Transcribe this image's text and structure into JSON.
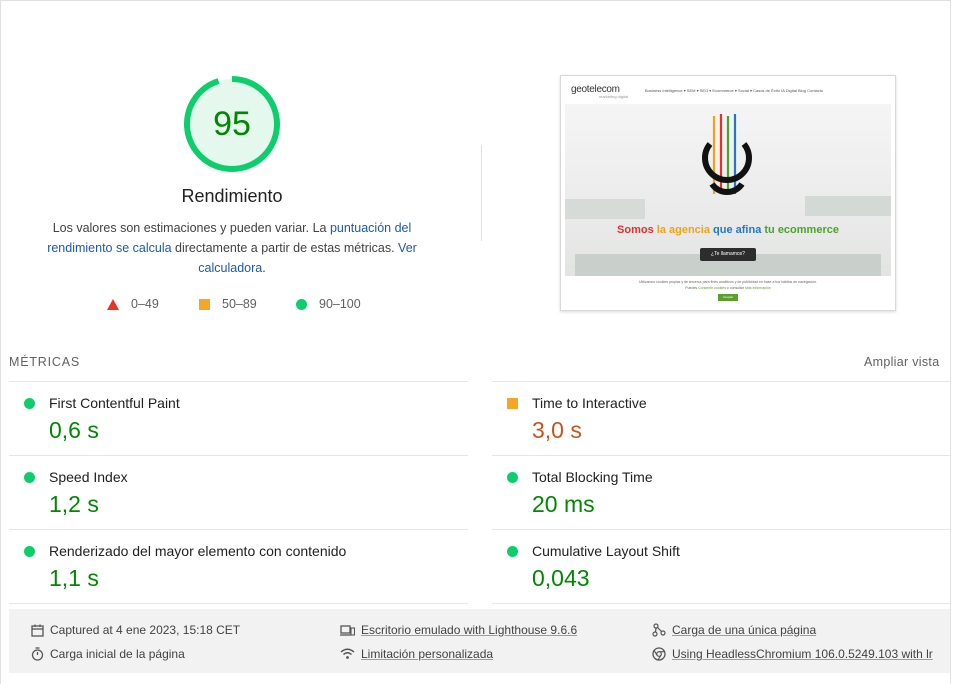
{
  "score": {
    "value": "95",
    "fraction": 0.95,
    "title": "Rendimiento",
    "color": "#0cce6b"
  },
  "description": {
    "text_1": "Los valores son estimaciones y pueden variar. La ",
    "link_1": "puntuación del rendimiento se calcula",
    "text_2": " directamente a partir de estas métricas. ",
    "link_2": "Ver calculadora",
    "text_3": "."
  },
  "legend": {
    "fail": "0–49",
    "average": "50–89",
    "pass": "90–100",
    "colors": {
      "fail": "#eb3324",
      "average": "#f4a626",
      "pass": "#0cce6b"
    }
  },
  "screenshot": {
    "logo": "geotelecom",
    "logo_sub": "marketing digital",
    "nav": "Business Intelligence ▾   SEM ▾   SEO ▾   Ecommerce ▾   Social ▾   Casos de Éxito   IA Digital   Blog   Contacto",
    "tagline_parts": [
      {
        "text": "Somos ",
        "color": "#e3312b"
      },
      {
        "text": "la agencia ",
        "color": "#f0a21a"
      },
      {
        "text": "que afina ",
        "color": "#1f78c8"
      },
      {
        "text": "tu ecommerce",
        "color": "#4ba32d"
      }
    ],
    "cta": "¿Te llamamos?",
    "footer_line1": "Utilizamos cookies propias y de terceros para fines analíticos y de publicidad en base a tus hábitos de navegación.",
    "footer_line2_prefix": "Puedes ",
    "footer_line2_link1": "Consentir cookies",
    "footer_line2_mid": " o consultar ",
    "footer_line2_link2": "Más información",
    "accept_button": "Aceptar"
  },
  "metrics": {
    "title": "MÉTRICAS",
    "expand_label": "Ampliar vista",
    "items": [
      {
        "label": "First Contentful Paint",
        "value": "0,6 s",
        "status": "pass"
      },
      {
        "label": "Time to Interactive",
        "value": "3,0 s",
        "status": "average"
      },
      {
        "label": "Speed Index",
        "value": "1,2 s",
        "status": "pass"
      },
      {
        "label": "Total Blocking Time",
        "value": "20 ms",
        "status": "pass"
      },
      {
        "label": "Renderizado del mayor elemento con contenido",
        "value": "1,1 s",
        "status": "pass"
      },
      {
        "label": "Cumulative Layout Shift",
        "value": "0,043",
        "status": "pass"
      }
    ]
  },
  "footer": {
    "captured": "Captured at 4 ene 2023, 15:18 CET",
    "initial_load": "Carga inicial de la página",
    "emulated": "Escritorio emulado with Lighthouse 9.6.6",
    "throttling": "Limitación personalizada",
    "single_page": "Carga de una única página",
    "browser": "Using HeadlessChromium 106.0.5249.103 with lr"
  }
}
